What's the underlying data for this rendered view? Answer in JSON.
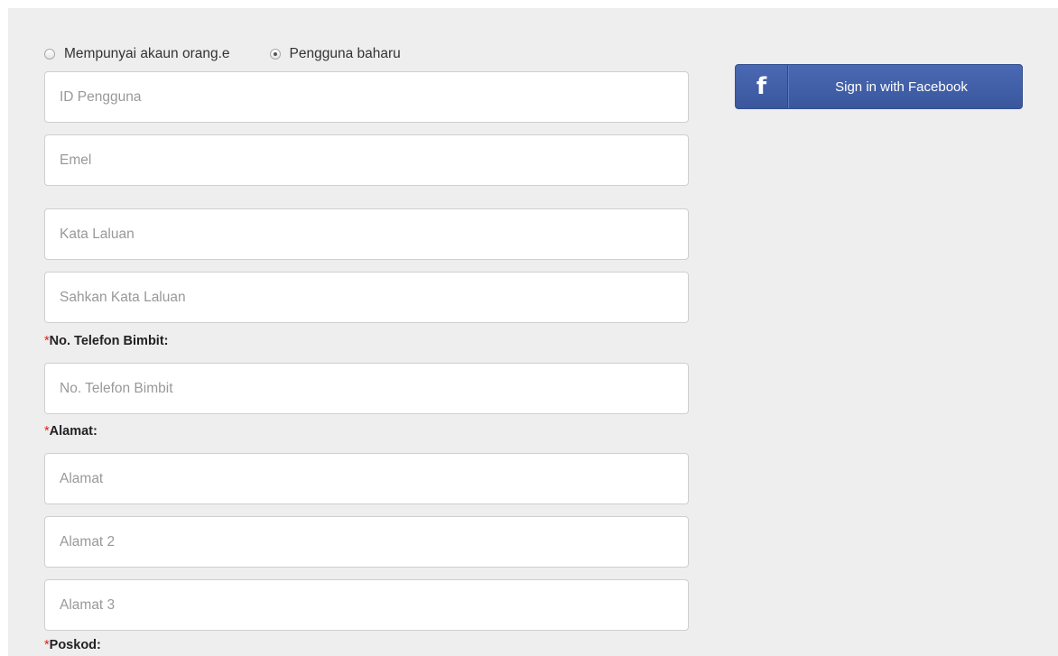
{
  "account_type": {
    "options": [
      {
        "label": "Mempunyai akaun orang.e",
        "checked": false
      },
      {
        "label": "Pengguna baharu",
        "checked": true
      }
    ]
  },
  "fields": {
    "user_id": {
      "placeholder": "ID Pengguna",
      "value": ""
    },
    "email": {
      "placeholder": "Emel",
      "value": ""
    },
    "password": {
      "placeholder": "Kata Laluan",
      "value": ""
    },
    "confirm_password": {
      "placeholder": "Sahkan Kata Laluan",
      "value": ""
    },
    "mobile": {
      "placeholder": "No. Telefon Bimbit",
      "value": ""
    },
    "address1": {
      "placeholder": "Alamat",
      "value": ""
    },
    "address2": {
      "placeholder": "Alamat 2",
      "value": ""
    },
    "address3": {
      "placeholder": "Alamat 3",
      "value": ""
    }
  },
  "labels": {
    "required_marker": "*",
    "mobile": "No. Telefon Bimbit:",
    "address": "Alamat:",
    "postcode": "Poskod:"
  },
  "facebook": {
    "icon_glyph": "f",
    "icon": "facebook-icon",
    "label": "Sign in with Facebook",
    "color": "#3b5998"
  }
}
